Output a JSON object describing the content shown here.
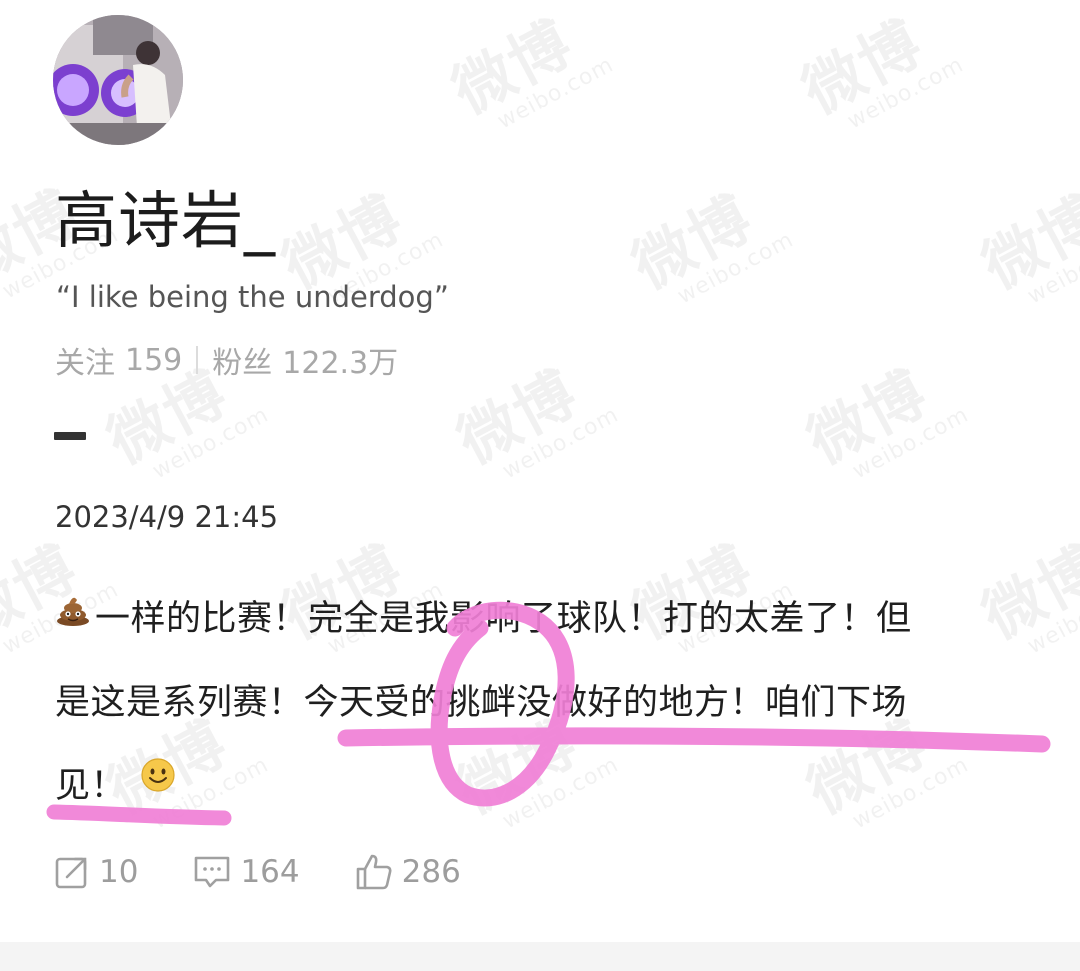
{
  "watermark": {
    "cn": "微博",
    "en": "weibo.com"
  },
  "profile": {
    "avatar": "avatar",
    "name": "高诗岩_",
    "bio": "“I like being the underdog”",
    "following_label": "关注",
    "following_count": "159",
    "followers_label": "粉丝",
    "followers_count": "122.3万"
  },
  "post": {
    "timestamp": "2023/4/9 21:45",
    "leading_emoji": "poop-emoji",
    "line1": "一样的比赛！完全是我影响了球队！打的太差了！但",
    "line2": "是这是系列赛！今天受的挑衅没做好的地方！咱们下场",
    "line3": "见！",
    "trailing_emoji": "smile-emoji"
  },
  "actions": {
    "repost_icon": "repost-icon",
    "repost_count": "10",
    "comment_icon": "comment-icon",
    "comment_count": "164",
    "like_icon": "thumbs-up-icon",
    "like_count": "286"
  },
  "colors": {
    "highlight": "#f07fd6",
    "muted": "#a8a8a8",
    "text": "#1f1f1f"
  }
}
